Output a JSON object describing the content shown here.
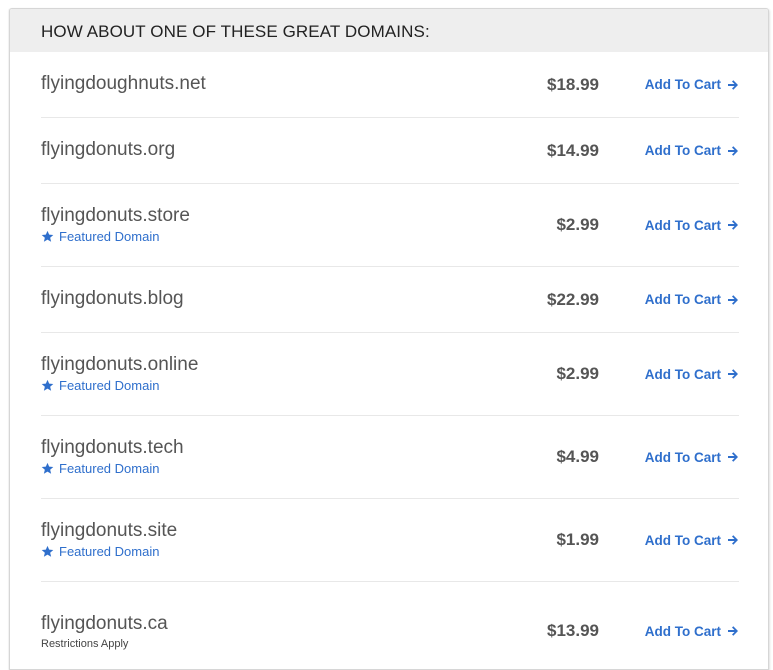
{
  "header": {
    "title": "HOW ABOUT ONE OF THESE GREAT DOMAINS:"
  },
  "colors": {
    "accent": "#2f6fcc",
    "text": "#555555",
    "header_bg": "#eeeeee"
  },
  "domains": [
    {
      "name": "flyingdoughnuts.net",
      "price": "$18.99",
      "cta": "Add To Cart",
      "note": null,
      "featured": null
    },
    {
      "name": "flyingdonuts.org",
      "price": "$14.99",
      "cta": "Add To Cart",
      "note": null,
      "featured": null
    },
    {
      "name": "flyingdonuts.store",
      "price": "$2.99",
      "cta": "Add To Cart",
      "note": null,
      "featured": "Featured Domain"
    },
    {
      "name": "flyingdonuts.blog",
      "price": "$22.99",
      "cta": "Add To Cart",
      "note": null,
      "featured": null
    },
    {
      "name": "flyingdonuts.online",
      "price": "$2.99",
      "cta": "Add To Cart",
      "note": null,
      "featured": "Featured Domain"
    },
    {
      "name": "flyingdonuts.tech",
      "price": "$4.99",
      "cta": "Add To Cart",
      "note": null,
      "featured": "Featured Domain"
    },
    {
      "name": "flyingdonuts.site",
      "price": "$1.99",
      "cta": "Add To Cart",
      "note": null,
      "featured": "Featured Domain"
    },
    {
      "name": "flyingdonuts.ca",
      "price": "$13.99",
      "cta": "Add To Cart",
      "note": "Restrictions Apply",
      "featured": null
    }
  ],
  "icons": {
    "featured": "star-icon",
    "cart": "arrow-right-icon"
  }
}
